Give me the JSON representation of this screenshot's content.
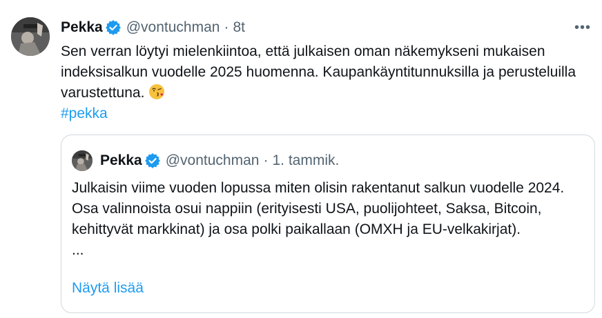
{
  "tweet": {
    "author_name": "Pekka",
    "handle": "@vontuchman",
    "separator": "·",
    "time": "8t",
    "more_icon": "•••",
    "text": "Sen verran löytyi mielenkiintoa, että julkaisen oman näkemykseni mukaisen indeksisalkun vuodelle 2025 huomenna. Kaupankäyntitunnuksilla ja perusteluilla varustettuna.",
    "emoji": "😘",
    "hashtag": "#pekka"
  },
  "quote": {
    "author_name": "Pekka",
    "handle": "@vontuchman",
    "separator": "·",
    "time": "1. tammik.",
    "text": "Julkaisin viime vuoden lopussa miten olisin rakentanut salkun vuodelle 2024. Osa valinnoista osui nappiin (erityisesti USA, puolijohteet, Saksa, Bitcoin, kehittyvät markkinat) ja osa polki paikallaan (OMXH ja EU-velkakirjat).",
    "ellipsis": "...",
    "show_more": "Näytä lisää"
  },
  "colors": {
    "link": "#1d9bf0",
    "secondary_text": "#536471",
    "border": "#cfd9de",
    "verified_badge": "#1d9bf0"
  }
}
